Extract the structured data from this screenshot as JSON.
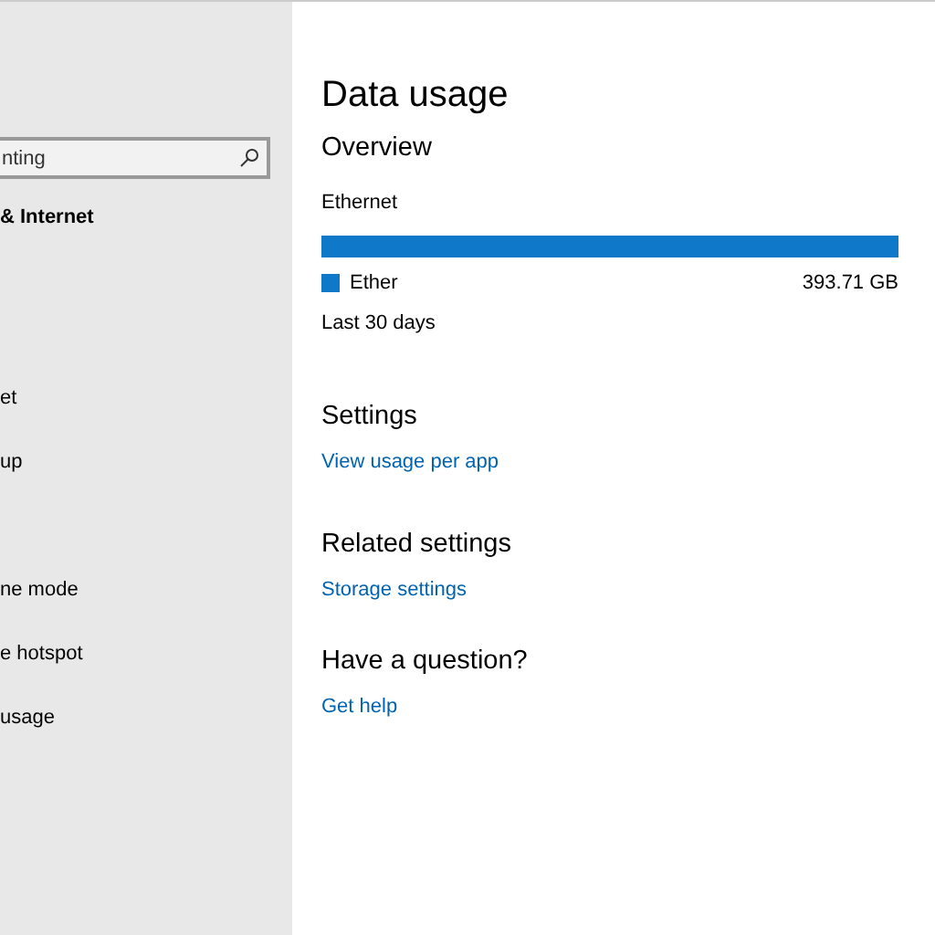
{
  "sidebar": {
    "search": {
      "value": "nting"
    },
    "section_title": "& Internet",
    "items": [
      {
        "label": "et"
      },
      {
        "label": "up"
      },
      {
        "label": "ne mode"
      },
      {
        "label": "e hotspot"
      },
      {
        "label": "usage"
      }
    ]
  },
  "main": {
    "title": "Data usage",
    "overview": {
      "heading": "Overview",
      "network_label": "Ethernet",
      "level": 1,
      "color": "#0f78c8",
      "legend_label": "Ether",
      "amount": "393.71 GB",
      "period": "Last 30 days"
    },
    "sections": [
      {
        "heading": "Settings",
        "link": "View usage per app"
      },
      {
        "heading": "Related settings",
        "link": "Storage settings"
      },
      {
        "heading": "Have a question?",
        "link": "Get help"
      }
    ]
  }
}
